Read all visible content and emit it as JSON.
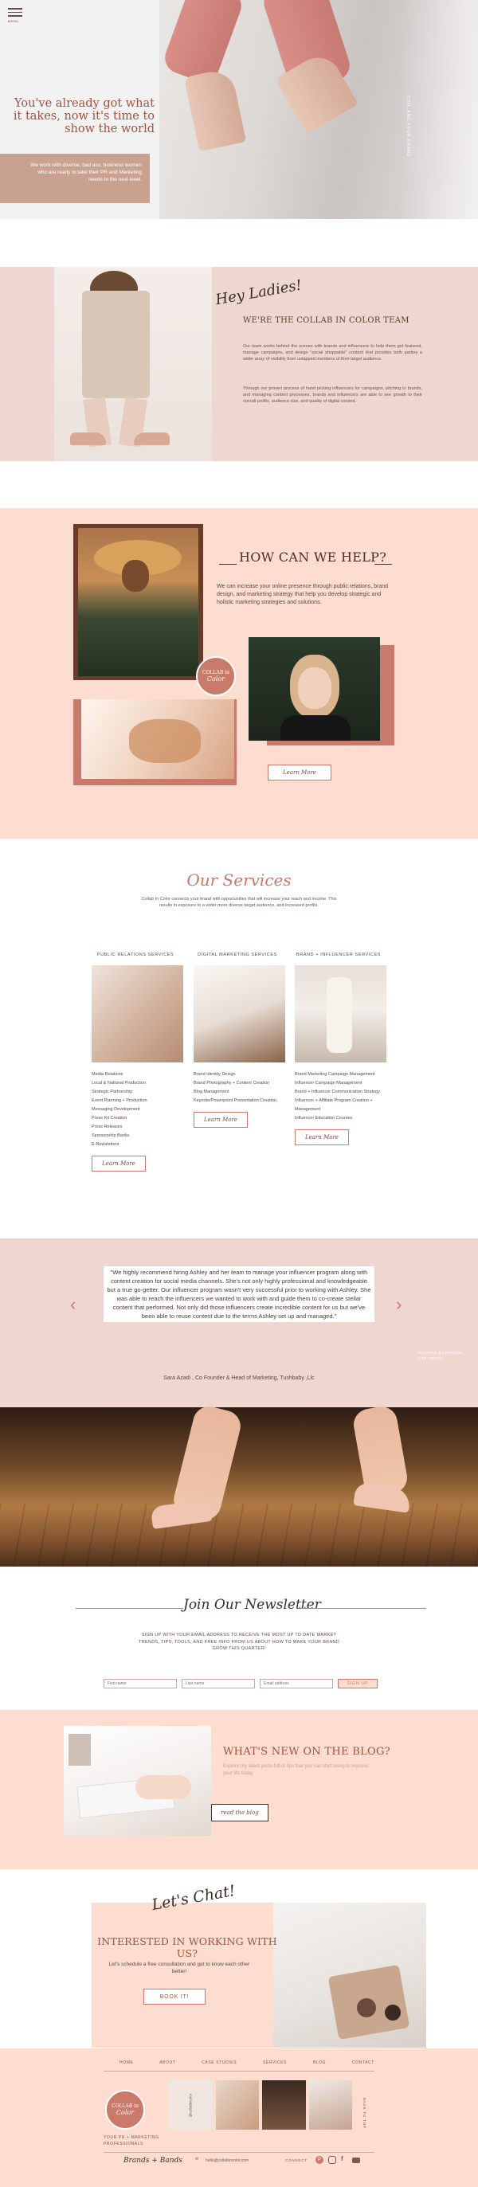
{
  "nav": {
    "menu_label": "MENU"
  },
  "hero": {
    "headline": "You've already got what it takes, now it's time to show the world",
    "subtext": "We work with diverse, bad ass, business women who are ready to take their PR and Marketing needs to the next level.",
    "side_text": "YOU. AND YOUR BRAND"
  },
  "team": {
    "script_heading": "Hey Ladies!",
    "heading": "WE'RE THE COLLAB IN COLOR TEAM",
    "paragraph_1": "Our team works behind the scenes with brands and influencers to help them get featured, manage campaigns, and design \"social shoppable\" content that provides both parties a wider array of visibility from untapped members of their target audience.",
    "paragraph_2": "Through our proven process of hand picking influencers for campaigns, pitching to brands, and managing content processes, brands and influencers are able to see growth to their overall profits, audience size, and quality of digital content."
  },
  "help": {
    "heading": "HOW CAN WE HELP?",
    "paragraph": "We can increase your online presence through public relations, brand design, and marketing strategy that help you develop strategic and holistic marketing strategies and solutions.",
    "badge_line_1": "COLLAB in",
    "badge_line_2": "Color",
    "button": "Learn More"
  },
  "services": {
    "script_heading": "Our Services",
    "intro": "Collab In Color connects your brand with opportunities that will increase your reach and income. This results in exposure to a wider more diverse target audience, and increased profits.",
    "columns": [
      {
        "title": "PUBLIC RELATIONS SERVICES",
        "items": [
          "Media Relations",
          "Local & National Production",
          "Strategic Partnership",
          "Event Planning + Production",
          "Messaging Development",
          "Press Kit Creation",
          "Press Releases",
          "Sponsorship Banks",
          "E-Newsletters"
        ],
        "button": "Learn More"
      },
      {
        "title": "DIGITAL MARKETING SERVICES",
        "items": [
          "Brand Identity Design",
          "Brand Photography + Content Creation",
          "Blog Management",
          "Keynote/Powerpoint Presentation Creation"
        ],
        "button": "Learn More"
      },
      {
        "title": "BRAND + INFLUENCER SERVICES",
        "items": [
          "Brand Marketing Campaign Management",
          "Influencer Campaign Management",
          "Brand + Influencer Communication Strategy",
          "Influencer + Affiliate Program Creation + Management",
          "Influencer Education Courses"
        ],
        "button": "Learn More"
      }
    ]
  },
  "testimonial": {
    "quote": "\"We highly recommend hiring Ashley and her team to manage your influencer program along with content creation for social media channels. She's not only highly professional and knowledgeable but a true go-getter. Our influencer program wasn't very successful prior to working with Ashley. She was able to reach the influencers we wanted to work with and guide them to co-create stellar content that performed. Not only did those influencers create incredible content for us but we've been able to reuse content due to the terms Ashley set up and managed.\"",
    "author": "Sara Azadi , Co Founder & Head of Marketing, Tushbaby ,Llc",
    "side_note": "TRUSTED BY BRANDS LIKE YOURS"
  },
  "newsletter": {
    "script_heading": "Join Our Newsletter",
    "description": "SIGN UP WITH YOUR EMAIL ADDRESS TO RECEIVE THE MOST UP TO DATE MARKET TRENDS, TIPS, TOOLS, AND FREE INFO FROM US ABOUT HOW TO MAKE YOUR BRAND GROW THIS QUARTER!",
    "first_name_placeholder": "First name",
    "last_name_placeholder": "Last name",
    "email_placeholder": "Email address",
    "submit": "SIGN UP"
  },
  "blog": {
    "heading": "WHAT'S NEW ON THE BLOG?",
    "subtext": "Explore my latest posts full of tips that you can start using to improve your life today.",
    "button": "read the blog"
  },
  "work": {
    "script_heading": "Let's Chat!",
    "heading": "INTERESTED IN WORKING WITH US?",
    "subtext": "Let's schedule a free consultation and get to know each other better!",
    "button": "BOOK IT!"
  },
  "footer": {
    "nav": [
      "HOME",
      "ABOUT",
      "CASE STUDIES",
      "SERVICES",
      "BLOG",
      "CONTACT"
    ],
    "logo_line_1": "COLLAB in",
    "logo_line_2": "Color",
    "tagline": "YOUR PR + MARKETING PROFESSIONALS",
    "instagram_tag": "@collabincolor",
    "back_to_top": "BACK TO TOP",
    "signature": "Brands + Bands",
    "email": "hello@collabincolor.com",
    "connect": "CONNECT"
  },
  "colors": {
    "accent": "#c9786a",
    "blush": "#fcddd0",
    "rose": "#eed7d1",
    "brown": "#7a4a40"
  }
}
